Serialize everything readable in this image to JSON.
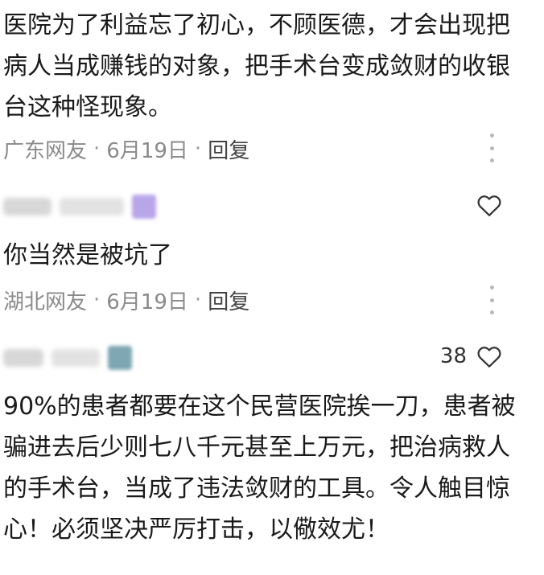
{
  "comments": [
    {
      "text": "医院为了利益忘了初心，不顾医德，才会出现把病人当成赚钱的对象，把手术台变成敛财的收银台这种怪现象。",
      "location": "广东网友",
      "date": "6月19日",
      "reply_label": "回复"
    },
    {
      "text": "你当然是被坑了",
      "location": "湖北网友",
      "date": "6月19日",
      "reply_label": "回复",
      "likes": ""
    },
    {
      "text": "90%的患者都要在这个民营医院挨一刀，患者被骗进去后少则七八千元甚至上万元，把治病救人的手术台，当成了违法敛财的工具。令人触目惊心！必须坚决严厉打击，以儆效尤！",
      "likes": "38"
    }
  ],
  "separator": "·",
  "icons": {
    "like": "heart-outline-icon",
    "more": "more-vertical-icon"
  },
  "colors": {
    "text": "#1a1a1a",
    "meta": "#8a8a8a",
    "icon": "#333333",
    "avatar_purple": "#b9a6e8",
    "avatar_teal": "#7fa6b3"
  }
}
